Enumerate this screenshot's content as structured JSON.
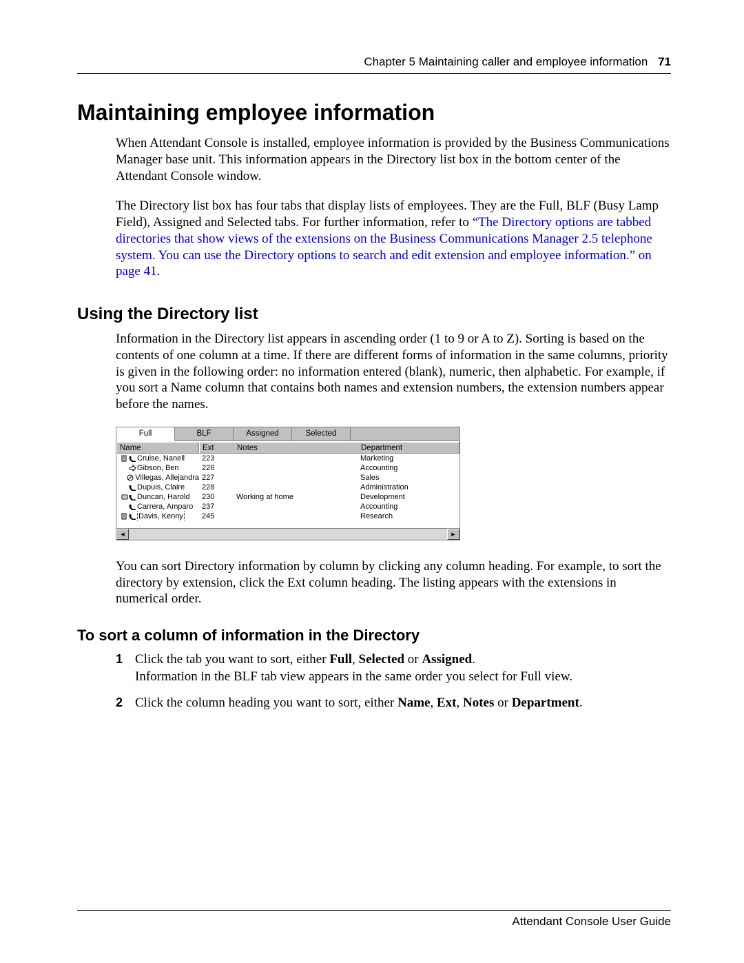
{
  "header": {
    "chapter": "Chapter 5  Maintaining caller and employee information",
    "page": "71"
  },
  "h1": "Maintaining employee information",
  "p1": "When Attendant Console is installed, employee information is provided by the Business Communications Manager base unit. This information appears in the Directory list box in the bottom center of the Attendant Console window.",
  "p2_pre": "The Directory list box has four tabs that display lists of employees. They are the Full, BLF (Busy Lamp Field), Assigned and Selected tabs. For further information, refer to ",
  "p2_link": "“The Directory options are tabbed directories that show views of the extensions on the Business Communications Manager 2.5 telephone system. You can use the Directory options to search and edit extension and employee information.” on page 41",
  "p2_post": ".",
  "h2": "Using the Directory list",
  "p3": "Information in the Directory list appears in ascending order (1 to 9 or A to Z). Sorting is based on the contents of one column at a time. If there are different forms of information in the same columns, priority is given in the following order: no information entered (blank), numeric, then alphabetic. For example, if you sort a Name column that contains both names and extension numbers, the extension numbers appear before the names.",
  "directory": {
    "tabs": [
      "Full",
      "BLF",
      "Assigned",
      "Selected"
    ],
    "active_tab_index": 0,
    "columns": [
      "Name",
      "Ext",
      "Notes",
      "Department"
    ],
    "rows": [
      {
        "pre": [
          "note",
          "phone"
        ],
        "name": "Cruise, Nanell",
        "ext": "223",
        "notes": "",
        "dept": "Marketing",
        "sel": false
      },
      {
        "pre": [
          "fwd"
        ],
        "name": "Gibson, Ben",
        "ext": "226",
        "notes": "",
        "dept": "Accounting",
        "sel": false
      },
      {
        "pre": [
          "dnd"
        ],
        "name": "Villegas, Allejandra",
        "ext": "227",
        "notes": "",
        "dept": "Sales",
        "sel": false
      },
      {
        "pre": [
          "phone"
        ],
        "name": "Dupuis, Claire",
        "ext": "228",
        "notes": "",
        "dept": "Administration",
        "sel": false
      },
      {
        "pre": [
          "msg",
          "phone"
        ],
        "name": "Duncan, Harold",
        "ext": "230",
        "notes": "Working at home",
        "dept": "Development",
        "sel": false
      },
      {
        "pre": [
          "phone"
        ],
        "name": "Carrera, Amparo",
        "ext": "237",
        "notes": "",
        "dept": "Accounting",
        "sel": false
      },
      {
        "pre": [
          "note",
          "phone"
        ],
        "name": "Davis, Kenny",
        "ext": "245",
        "notes": "",
        "dept": "Research",
        "sel": true
      }
    ]
  },
  "p4": "You can sort Directory information by column by clicking any column heading. For example, to sort the directory by extension, click the Ext column heading. The listing appears with the extensions in numerical order.",
  "h3": "To sort a column of information in the Directory",
  "steps": {
    "s1_a": "Click the tab you want to sort, either ",
    "s1_b1": "Full",
    "s1_c": ", ",
    "s1_b2": "Selected",
    "s1_d": " or ",
    "s1_b3": "Assigned",
    "s1_e": ".",
    "s1_line2": "Information in the BLF tab view appears in the same order you select for Full view.",
    "s2_a": "Click the column heading you want to sort, either ",
    "s2_b1": "Name",
    "s2_c": ", ",
    "s2_b2": "Ext",
    "s2_d": ", ",
    "s2_b3": "Notes",
    "s2_e": " or ",
    "s2_b4": "Department",
    "s2_f": "."
  },
  "footer": "Attendant Console User Guide"
}
